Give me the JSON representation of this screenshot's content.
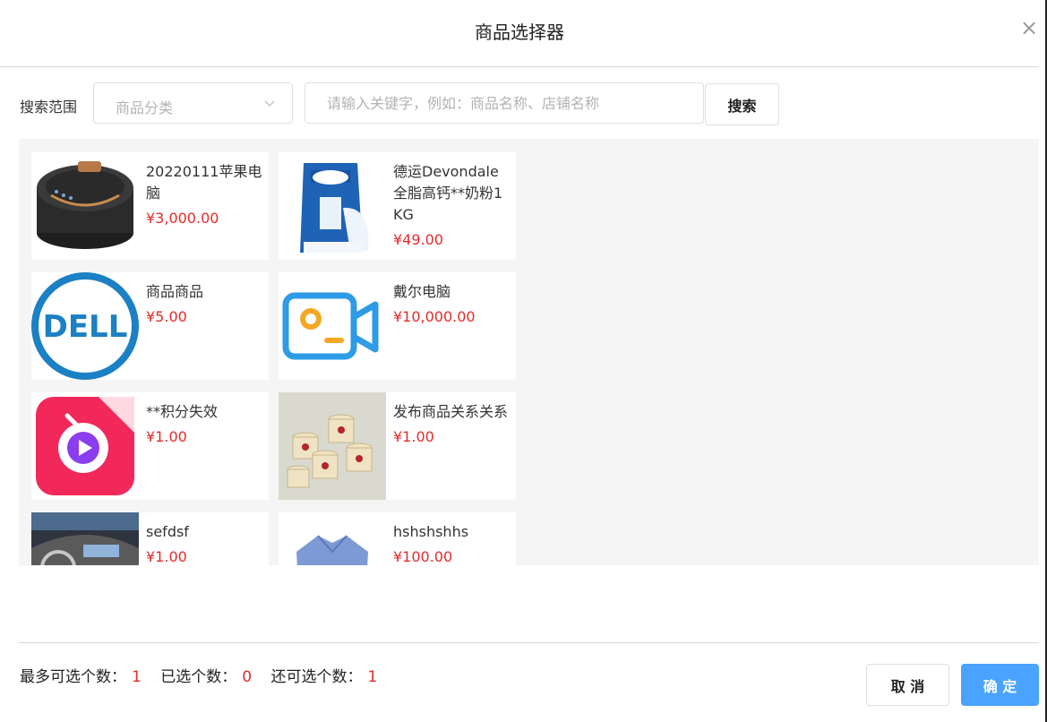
{
  "dialog": {
    "title": "商品选择器",
    "close_icon": "close-icon"
  },
  "search": {
    "label": "搜索范围",
    "category_value": "商品分类",
    "keyword_placeholder": "请输入关键字，例如：商品名称、店铺名称",
    "keyword_value": "",
    "button_label": "搜索"
  },
  "products": [
    {
      "name": "20220111苹果电脑",
      "price": "¥3,000.00",
      "image": "rice-cooker-image"
    },
    {
      "name": "德运Devondale全脂高钙**奶粉1KG",
      "price": "¥49.00",
      "image": "milk-powder-image"
    },
    {
      "name": "商品商品",
      "price": "¥5.00",
      "image": "dell-logo-image"
    },
    {
      "name": "戴尔电脑",
      "price": "¥10,000.00",
      "image": "video-camera-app-icon"
    },
    {
      "name": "**积分失效",
      "price": "¥1.00",
      "image": "live-stream-app-icon"
    },
    {
      "name": "发布商品关系关系",
      "price": "¥1.00",
      "image": "ice-cream-cups-image"
    },
    {
      "name": "sefdsf",
      "price": "¥1.00",
      "image": "car-interior-image"
    },
    {
      "name": "hshshshhs",
      "price": "¥100.00",
      "image": "shirt-image"
    }
  ],
  "footer": {
    "max_label": "最多可选个数：",
    "max_value": "1",
    "selected_label": "已选个数：",
    "selected_value": "0",
    "remaining_label": "还可选个数：",
    "remaining_value": "1",
    "cancel_label": "取 消",
    "confirm_label": "确 定"
  },
  "colors": {
    "price": "#e62b2b",
    "primary": "#4aa3ff",
    "list_bg": "#f5f5f5"
  }
}
